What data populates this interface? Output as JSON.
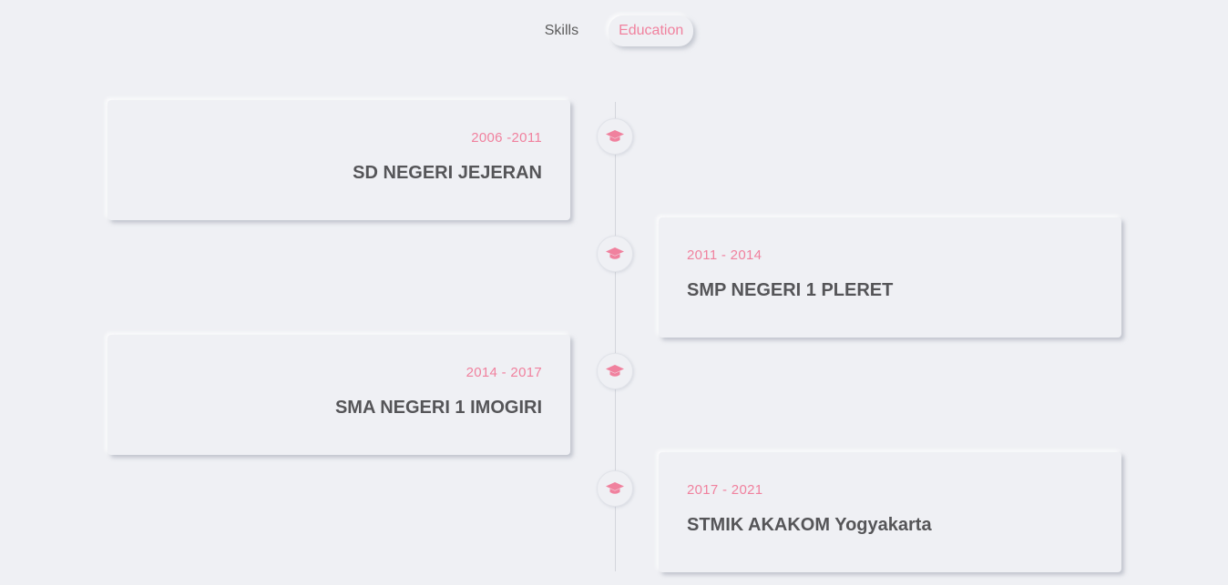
{
  "tabs": [
    {
      "label": "Skills",
      "active": false
    },
    {
      "label": "Education",
      "active": true
    }
  ],
  "accent_color": "#f0819e",
  "text_color": "#555558",
  "timeline_icon": "graduation-cap-icon",
  "education": [
    {
      "years": "2006 -2011",
      "school": "SD NEGERI JEJERAN",
      "side": "left"
    },
    {
      "years": "2011 - 2014",
      "school": "SMP NEGERI 1 PLERET",
      "side": "right"
    },
    {
      "years": "2014 - 2017",
      "school": "SMA NEGERI 1 IMOGIRI",
      "side": "left"
    },
    {
      "years": "2017 - 2021",
      "school": "STMIK AKAKOM Yogyakarta",
      "side": "right"
    }
  ]
}
